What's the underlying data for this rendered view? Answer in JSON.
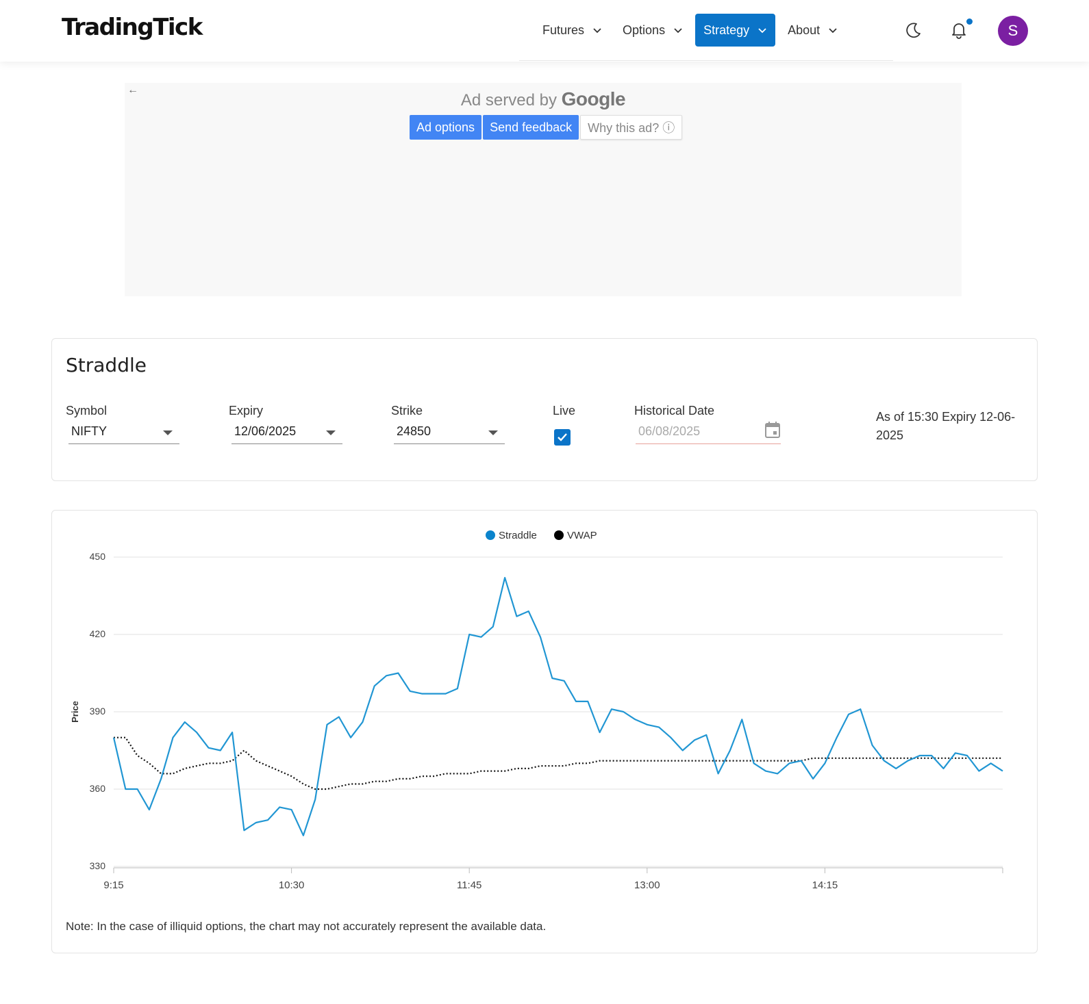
{
  "header": {
    "logo": "TradingTick",
    "nav": [
      {
        "label": "Futures",
        "active": false
      },
      {
        "label": "Options",
        "active": false
      },
      {
        "label": "Strategy",
        "active": true
      },
      {
        "label": "About",
        "active": false
      }
    ],
    "avatar_initial": "S",
    "icons": [
      "moon-icon",
      "bell-icon"
    ]
  },
  "ad": {
    "served_prefix": "Ad served by",
    "served_brand": "Google",
    "buttons": {
      "options": "Ad options",
      "feedback": "Send feedback",
      "why": "Why this ad? ⓘ"
    }
  },
  "form": {
    "title": "Straddle",
    "symbol_label": "Symbol",
    "symbol_value": "NIFTY",
    "expiry_label": "Expiry",
    "expiry_value": "12/06/2025",
    "strike_label": "Strike",
    "strike_value": "24850",
    "live_label": "Live",
    "live_checked": true,
    "historical_label": "Historical Date",
    "historical_value": "06/08/2025",
    "asof_text": "As of 15:30 Expiry 12-06-2025"
  },
  "chart_data": {
    "type": "line",
    "ylabel": "Price",
    "ylim": [
      330,
      450
    ],
    "yticks": [
      450,
      420,
      390,
      360,
      330
    ],
    "xlim": [
      "9:15",
      "15:30"
    ],
    "xticks": [
      "9:15",
      "10:30",
      "11:45",
      "13:00",
      "14:15"
    ],
    "grid": true,
    "legend": "top-center",
    "series": [
      {
        "name": "Straddle",
        "color": "#2196d3",
        "style": "solid",
        "x": [
          "9:15",
          "9:20",
          "9:25",
          "9:30",
          "9:35",
          "9:40",
          "9:45",
          "9:50",
          "9:55",
          "10:00",
          "10:05",
          "10:10",
          "10:15",
          "10:20",
          "10:25",
          "10:30",
          "10:35",
          "10:40",
          "10:45",
          "10:50",
          "10:55",
          "11:00",
          "11:05",
          "11:10",
          "11:15",
          "11:20",
          "11:25",
          "11:30",
          "11:35",
          "11:40",
          "11:45",
          "11:50",
          "11:55",
          "12:00",
          "12:05",
          "12:10",
          "12:15",
          "12:20",
          "12:25",
          "12:30",
          "12:35",
          "12:40",
          "12:45",
          "12:50",
          "12:55",
          "13:00",
          "13:05",
          "13:10",
          "13:15",
          "13:20",
          "13:25",
          "13:30",
          "13:35",
          "13:40",
          "13:45",
          "13:50",
          "13:55",
          "14:00",
          "14:05",
          "14:10",
          "14:15",
          "14:20",
          "14:25",
          "14:30",
          "14:35",
          "14:40",
          "14:45",
          "14:50",
          "14:55",
          "15:00",
          "15:05",
          "15:10",
          "15:15",
          "15:20",
          "15:25",
          "15:30"
        ],
        "values": [
          380,
          360,
          360,
          352,
          364,
          380,
          386,
          382,
          376,
          375,
          382,
          344,
          347,
          348,
          353,
          352,
          342,
          356,
          385,
          388,
          380,
          386,
          400,
          404,
          405,
          398,
          397,
          397,
          397,
          399,
          420,
          419,
          423,
          442,
          427,
          429,
          419,
          403,
          402,
          394,
          394,
          382,
          391,
          390,
          387,
          385,
          384,
          380,
          375,
          379,
          381,
          366,
          375,
          387,
          370,
          367,
          366,
          370,
          371,
          364,
          370,
          380,
          389,
          391,
          377,
          371,
          368,
          371,
          373,
          373,
          368,
          374,
          373,
          367,
          370,
          367
        ]
      },
      {
        "name": "VWAP",
        "color": "#111111",
        "style": "dotted",
        "x": [
          "9:15",
          "9:20",
          "9:25",
          "9:30",
          "9:35",
          "9:40",
          "9:45",
          "9:50",
          "9:55",
          "10:00",
          "10:05",
          "10:10",
          "10:15",
          "10:20",
          "10:25",
          "10:30",
          "10:35",
          "10:40",
          "10:45",
          "10:50",
          "10:55",
          "11:00",
          "11:05",
          "11:10",
          "11:15",
          "11:20",
          "11:25",
          "11:30",
          "11:35",
          "11:40",
          "11:45",
          "11:50",
          "11:55",
          "12:00",
          "12:05",
          "12:10",
          "12:15",
          "12:20",
          "12:25",
          "12:30",
          "12:35",
          "12:40",
          "12:45",
          "12:50",
          "12:55",
          "13:00",
          "13:05",
          "13:10",
          "13:15",
          "13:20",
          "13:25",
          "13:30",
          "13:35",
          "13:40",
          "13:45",
          "13:50",
          "13:55",
          "14:00",
          "14:05",
          "14:10",
          "14:15",
          "14:20",
          "14:25",
          "14:30",
          "14:35",
          "14:40",
          "14:45",
          "14:50",
          "14:55",
          "15:00",
          "15:05",
          "15:10",
          "15:15",
          "15:20",
          "15:25",
          "15:30"
        ],
        "values": [
          380,
          380,
          373,
          370,
          366,
          366,
          368,
          369,
          370,
          370,
          371,
          375,
          371,
          369,
          367,
          365,
          362,
          360,
          360,
          361,
          362,
          362,
          363,
          363,
          364,
          364,
          365,
          365,
          366,
          366,
          366,
          367,
          367,
          367,
          368,
          368,
          369,
          369,
          369,
          370,
          370,
          371,
          371,
          371,
          371,
          371,
          371,
          371,
          371,
          371,
          371,
          371,
          371,
          371,
          371,
          371,
          371,
          371,
          371,
          372,
          372,
          372,
          372,
          372,
          372,
          372,
          372,
          372,
          372,
          372,
          372,
          372,
          372,
          372,
          372,
          372
        ]
      }
    ]
  },
  "note": "Note: In the case of illiquid options, the chart may not accurately represent the available data."
}
